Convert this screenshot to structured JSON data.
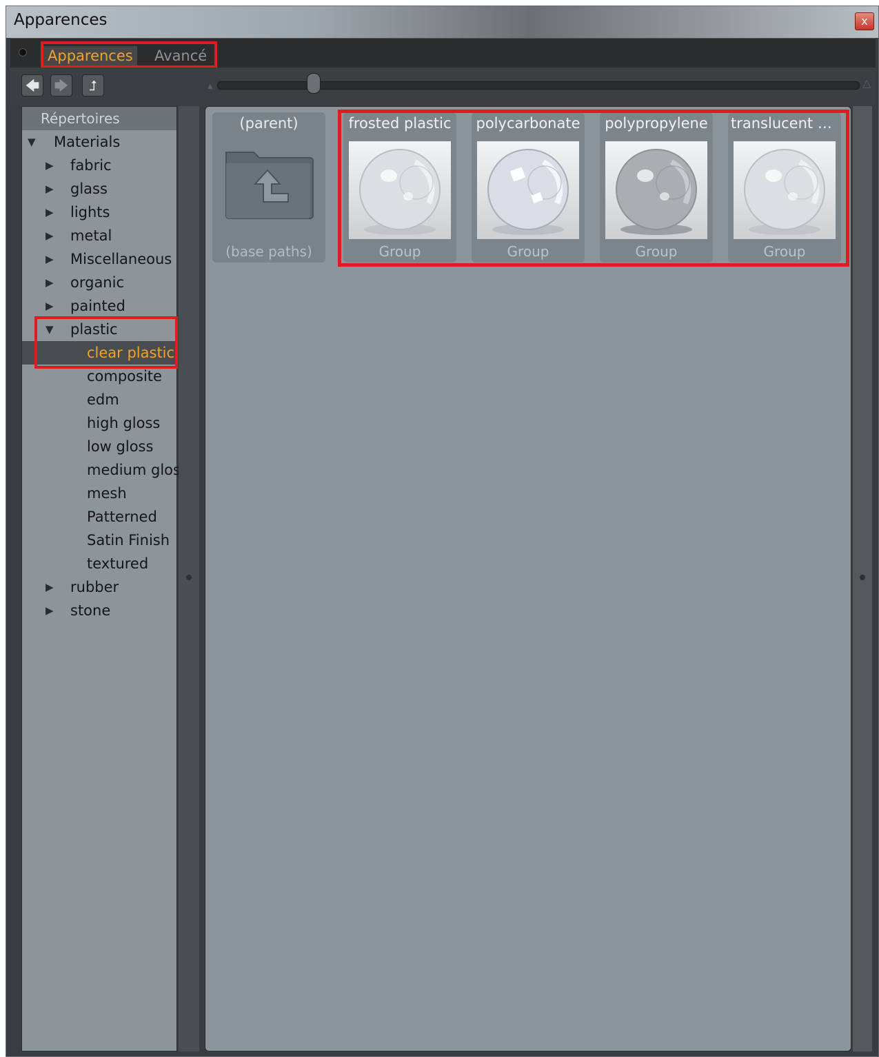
{
  "window": {
    "title": "Apparences",
    "close_glyph": "x"
  },
  "tabs": [
    {
      "label": "Apparences",
      "active": true
    },
    {
      "label": "Avancé",
      "active": false
    }
  ],
  "toolbar": {
    "back_icon": "arrow-left-icon",
    "forward_icon": "arrow-right-icon",
    "up_icon": "up-level-icon",
    "back_glyph": "🡄",
    "forward_glyph": "🡆",
    "up_glyph": "⮥",
    "slider_min_glyph": "▲",
    "slider_max_glyph": "△"
  },
  "sidebar": {
    "header": "Répertoires",
    "root": {
      "label": "Materials",
      "expanded": true
    },
    "items": [
      {
        "label": "fabric",
        "level": 1,
        "arrow": "▶"
      },
      {
        "label": "glass",
        "level": 1,
        "arrow": "▶"
      },
      {
        "label": "lights",
        "level": 1,
        "arrow": "▶"
      },
      {
        "label": "metal",
        "level": 1,
        "arrow": "▶"
      },
      {
        "label": "Miscellaneous",
        "level": 1,
        "arrow": "▶"
      },
      {
        "label": "organic",
        "level": 1,
        "arrow": "▶"
      },
      {
        "label": "painted",
        "level": 1,
        "arrow": "▶"
      },
      {
        "label": "plastic",
        "level": 1,
        "arrow": "▼"
      },
      {
        "label": "clear plastic",
        "level": 2,
        "arrow": "",
        "selected": true
      },
      {
        "label": "composite",
        "level": 2,
        "arrow": ""
      },
      {
        "label": "edm",
        "level": 2,
        "arrow": ""
      },
      {
        "label": "high gloss",
        "level": 2,
        "arrow": ""
      },
      {
        "label": "low gloss",
        "level": 2,
        "arrow": ""
      },
      {
        "label": "medium gloss",
        "level": 2,
        "arrow": ""
      },
      {
        "label": "mesh",
        "level": 2,
        "arrow": ""
      },
      {
        "label": "Patterned",
        "level": 2,
        "arrow": ""
      },
      {
        "label": "Satin Finish",
        "level": 2,
        "arrow": ""
      },
      {
        "label": "textured",
        "level": 2,
        "arrow": ""
      },
      {
        "label": "rubber",
        "level": 1,
        "arrow": "▶"
      },
      {
        "label": "stone",
        "level": 1,
        "arrow": "▶"
      }
    ]
  },
  "content": {
    "parent": {
      "name": "(parent)",
      "sub": "(base paths)"
    },
    "materials": [
      {
        "name": "frosted plastic",
        "sub": "Group",
        "style": "frosted"
      },
      {
        "name": "polycarbonate",
        "sub": "Group",
        "style": "clear"
      },
      {
        "name": "polypropylene",
        "sub": "Group",
        "style": "grey"
      },
      {
        "name": "translucent p…",
        "sub": "Group",
        "style": "frosted"
      }
    ]
  },
  "colors": {
    "accent": "#f2a327",
    "highlight": "#e01b22",
    "panel": "#8d959c"
  }
}
